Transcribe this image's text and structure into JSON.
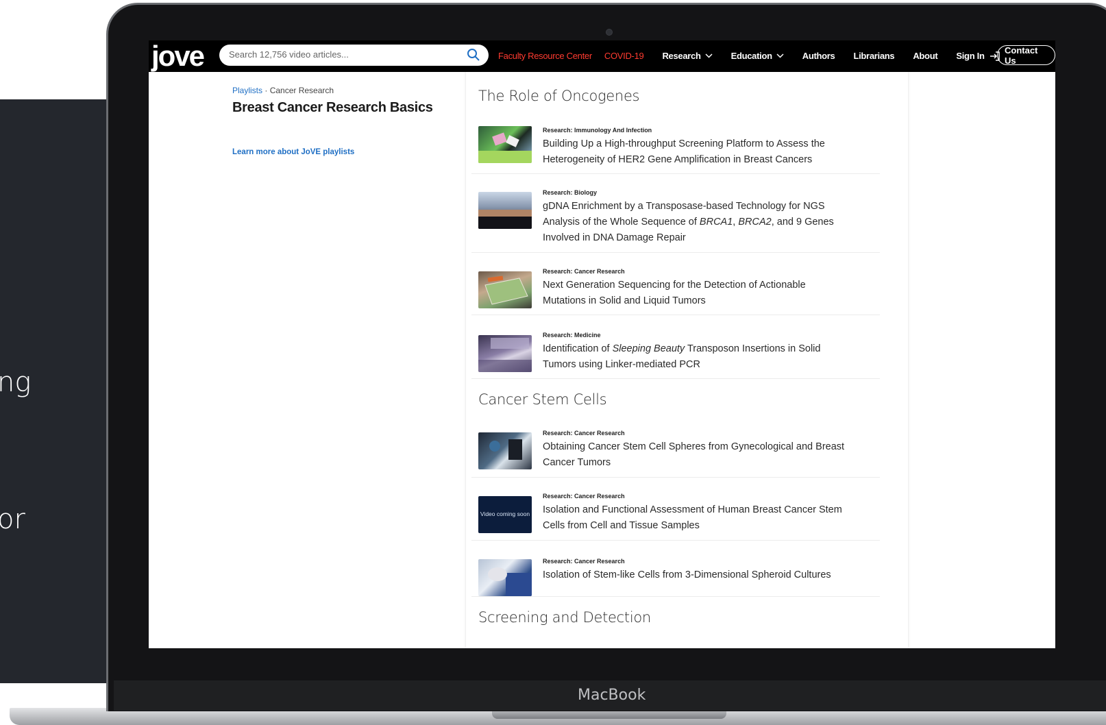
{
  "background": {
    "text_1": "ng",
    "text_2": "or"
  },
  "device": {
    "brand": "MacBook"
  },
  "nav": {
    "logo": "jove",
    "search_placeholder": "Search 12,756 video articles...",
    "faculty": "Faculty Resource Center",
    "covid": "COVID-19",
    "research": "Research",
    "education": "Education",
    "authors": "Authors",
    "librarians": "Librarians",
    "about": "About",
    "sign_in": "Sign In",
    "contact": "Contact Us",
    "accent_color": "#ff3b30"
  },
  "sidebar": {
    "crumb_playlists": "Playlists",
    "crumb_sep": " · ",
    "crumb_category": "Cancer Research",
    "title": "Breast Cancer Research Basics",
    "learn_more": "Learn more about JoVE playlists"
  },
  "sections": [
    {
      "title": "The Role of Oncogenes",
      "items": [
        {
          "category": "Research: Immunology And Infection",
          "title_line1": "Building Up a High-throughput Screening Platform to Assess the",
          "title_line2": "Heterogeneity of HER2 Gene Amplification in Breast Cancers"
        },
        {
          "category": "Research: Biology",
          "title_line1": "gDNA Enrichment by a Transposase-based Technology for NGS",
          "title_line2_a": "Analysis of the Whole Sequence of ",
          "title_line2_b": "BRCA1",
          "title_line2_c": ", ",
          "title_line2_d": "BRCA2",
          "title_line2_e": ", and 9 Genes",
          "title_line3": "Involved in DNA Damage Repair"
        },
        {
          "category": "Research: Cancer Research",
          "title_line1": "Next Generation Sequencing for the Detection of Actionable",
          "title_line2": "Mutations in Solid and Liquid Tumors"
        },
        {
          "category": "Research: Medicine",
          "title_line1_a": "Identification of ",
          "title_line1_b": "Sleeping Beauty",
          "title_line1_c": " Transposon Insertions in Solid",
          "title_line2": "Tumors using Linker-mediated PCR"
        }
      ]
    },
    {
      "title": "Cancer Stem Cells",
      "items": [
        {
          "category": "Research: Cancer Research",
          "title_line1": "Obtaining Cancer Stem Cell Spheres from Gynecological and Breast",
          "title_line2": "Cancer Tumors"
        },
        {
          "category": "Research: Cancer Research",
          "thumb_text": "Video coming soon",
          "title_line1": "Isolation and Functional Assessment of Human Breast Cancer Stem",
          "title_line2": "Cells from Cell and Tissue Samples"
        },
        {
          "category": "Research: Cancer Research",
          "title_line1": "Isolation of Stem-like Cells from 3-Dimensional Spheroid Cultures"
        }
      ]
    },
    {
      "title": "Screening and Detection",
      "items": []
    }
  ]
}
